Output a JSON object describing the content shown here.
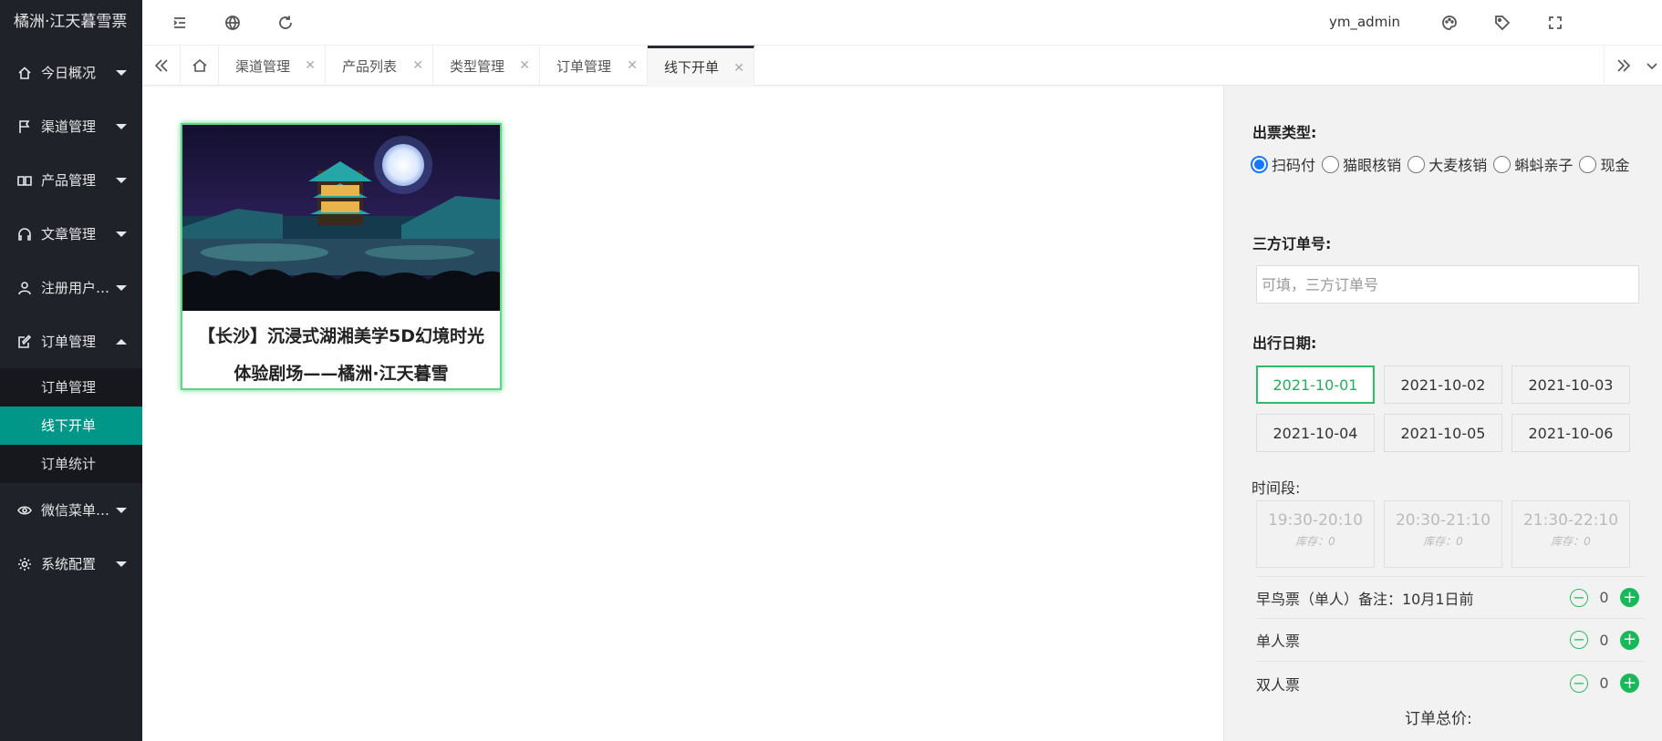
{
  "app": {
    "logo": "橘洲·江天暮雪票"
  },
  "sidebar": {
    "items": [
      {
        "label": "今日概况",
        "icon": "home-icon"
      },
      {
        "label": "渠道管理",
        "icon": "flag-icon"
      },
      {
        "label": "产品管理",
        "icon": "book-icon"
      },
      {
        "label": "文章管理",
        "icon": "headset-icon"
      },
      {
        "label": "注册用户…",
        "icon": "user-icon"
      },
      {
        "label": "订单管理",
        "icon": "form-icon"
      },
      {
        "label": "微信菜单…",
        "icon": "eye-icon"
      },
      {
        "label": "系统配置",
        "icon": "gear-icon"
      }
    ],
    "submenu": [
      {
        "label": "订单管理"
      },
      {
        "label": "线下开单"
      },
      {
        "label": "订单统计"
      }
    ]
  },
  "header": {
    "user": "ym_admin"
  },
  "tabs": [
    {
      "label": "渠道管理"
    },
    {
      "label": "产品列表"
    },
    {
      "label": "类型管理"
    },
    {
      "label": "订单管理"
    },
    {
      "label": "线下开单"
    }
  ],
  "product": {
    "title_line1": "【长沙】沉浸式湖湘美学5D幻境时光",
    "title_line2": "体验剧场——橘洲·江天暮雪"
  },
  "panel": {
    "ticket_type_label": "出票类型:",
    "ticket_types": [
      "扫码付",
      "猫眼核销",
      "大麦核销",
      "蝌蚪亲子",
      "现金"
    ],
    "selected_type": "扫码付",
    "order_no_label": "三方订单号:",
    "order_no_placeholder": "可填，三方订单号",
    "order_no_value": "",
    "date_label": "出行日期:",
    "dates": [
      "2021-10-01",
      "2021-10-02",
      "2021-10-03",
      "2021-10-04",
      "2021-10-05",
      "2021-10-06"
    ],
    "selected_date": "2021-10-01",
    "timeslot_label": "时间段:",
    "timeslots": [
      {
        "time": "19:30-20:10",
        "stock": "库存：0"
      },
      {
        "time": "20:30-21:10",
        "stock": "库存：0"
      },
      {
        "time": "21:30-22:10",
        "stock": "库存：0"
      }
    ],
    "tickets": [
      {
        "name": "早鸟票（单人）备注：10月1日前",
        "qty": "0"
      },
      {
        "name": "单人票",
        "qty": "0"
      },
      {
        "name": "双人票",
        "qty": "0"
      }
    ],
    "total_label": "订单总价:"
  },
  "colors": {
    "accent": "#009688",
    "success": "#19b85a",
    "radio": "#1677ff",
    "sidebar_bg": "#20222a"
  }
}
